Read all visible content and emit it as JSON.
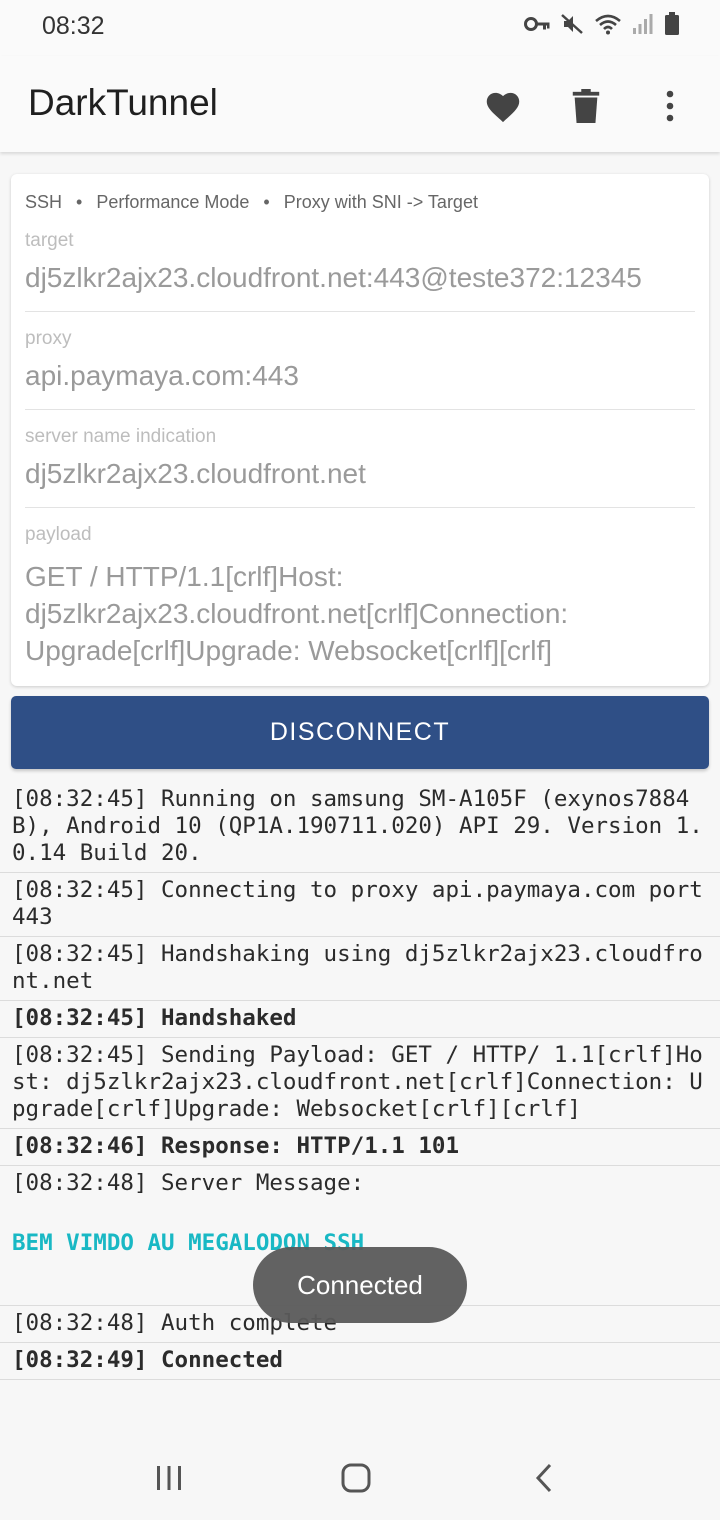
{
  "status_bar": {
    "time": "08:32",
    "icons": [
      "vpn-key-icon",
      "mute-icon",
      "wifi-icon",
      "signal-icon",
      "battery-icon"
    ]
  },
  "app_bar": {
    "title": "DarkTunnel",
    "actions": [
      "favorite-icon",
      "delete-icon",
      "more-vert-icon"
    ]
  },
  "config": {
    "mode_ssh": "SSH",
    "mode_performance": "Performance Mode",
    "mode_proxy": "Proxy with SNI -> Target",
    "separator": "•",
    "target_label": "target",
    "target_value": "dj5zlkr2ajx23.cloudfront.net:443@teste372:12345",
    "proxy_label": "proxy",
    "proxy_value": "api.paymaya.com:443",
    "sni_label": "server name indication",
    "sni_value": "dj5zlkr2ajx23.cloudfront.net",
    "payload_label": "payload",
    "payload_value": "GET / HTTP/1.1[crlf]Host: dj5zlkr2ajx23.cloudfront.net[crlf]Connection: Upgrade[crlf]Upgrade: Websocket[crlf][crlf]"
  },
  "button": {
    "disconnect_label": "DISCONNECT"
  },
  "log": {
    "entries": [
      "[08:32:45] Running on samsung SM-A105F (exynos7884B), Android 10 (QP1A.190711.020) API 29. Version 1.0.14 Build 20.",
      "[08:32:45] Connecting to proxy api.paymaya.com port 443",
      "[08:32:45] Handshaking using dj5zlkr2ajx23.cloudfront.net",
      "[08:32:45] Handshaked",
      "[08:32:45] Sending Payload: GET / HTTP/ 1.1[crlf]Host: dj5zlkr2ajx23.cloudfront.net[crlf]Connection: Upgrade[crlf]Upgrade: Websocket[crlf][crlf]",
      "[08:32:46] Response: HTTP/1.1 101",
      "[08:32:48] Server Message:",
      "[08:32:48] Auth complete",
      "[08:32:49] Connected"
    ],
    "server_banner": "BEM VIMDO AU MEGALODON SSH",
    "banner_color": "#19b8c4"
  },
  "toast": {
    "message": "Connected"
  },
  "nav_bar": {
    "buttons": [
      "recents-icon",
      "home-icon",
      "back-icon"
    ]
  },
  "colors": {
    "accent": "#2f4f86"
  }
}
